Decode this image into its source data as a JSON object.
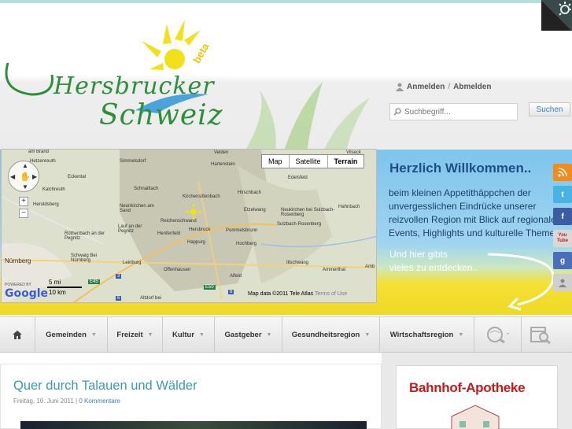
{
  "header": {
    "logo_line1": "Hersbrucker",
    "logo_line2": "Schweiz",
    "logo_badge": "beta",
    "login_label": "Anmelden",
    "logout_label": "Abmelden",
    "login_separator": "/",
    "search_placeholder": "Suchbegriff...",
    "search_button": "Suchen"
  },
  "map": {
    "type_buttons": [
      "Map",
      "Satellite",
      "Terrain"
    ],
    "selected_type": "Terrain",
    "places": [
      {
        "name": "am Brand"
      },
      {
        "name": "Hetzenreuth"
      },
      {
        "name": "Simmelsdorf"
      },
      {
        "name": "Hartenstein"
      },
      {
        "name": "Velden"
      },
      {
        "name": "Vilseck"
      },
      {
        "name": "Eckental"
      },
      {
        "name": "Kalchreuth"
      },
      {
        "name": "Schnaittach"
      },
      {
        "name": "Kirchensittenbach"
      },
      {
        "name": "Hirschbach"
      },
      {
        "name": "Edelsfeld"
      },
      {
        "name": "Heroldsberg"
      },
      {
        "name": "Neunkirchen am Sand"
      },
      {
        "name": "Etzelwang"
      },
      {
        "name": "Neukirchen bei Sulzbach-Rosenberg"
      },
      {
        "name": "Hahnbach"
      },
      {
        "name": "Lauf an der Pegnitz"
      },
      {
        "name": "Reichenschwand"
      },
      {
        "name": "Hersbruck"
      },
      {
        "name": "Pommelsbrunn"
      },
      {
        "name": "Sulzbach-Rosenberg"
      },
      {
        "name": "Röthenbach an der Pegnitz"
      },
      {
        "name": "Henfenfeld"
      },
      {
        "name": "Happurg"
      },
      {
        "name": "Hochberg"
      },
      {
        "name": "Nürnberg"
      },
      {
        "name": "Schwaig Bei Nürnberg"
      },
      {
        "name": "Leinburg"
      },
      {
        "name": "Offenhausen"
      },
      {
        "name": "Illschwang"
      },
      {
        "name": "Ammerthal"
      },
      {
        "name": "Alfeld"
      },
      {
        "name": "Altdorf bei"
      },
      {
        "name": "Amb"
      }
    ],
    "road_labels": [
      "E45",
      "E50",
      "3",
      "6",
      "6"
    ],
    "scale_miles": "5 mi",
    "scale_km": "10 km",
    "powered_by": "POWERED BY",
    "google_logo": "Google",
    "copyright": "Map data ©2011 Tele Atlas",
    "terms": "Terms of Use"
  },
  "welcome": {
    "title": "Herzlich Willkommen..",
    "text": "beim kleinen Appetithäppchen der unvergesslichen Eindrücke unserer reizvollen Region mit Blick auf regionale Events, Highlights und kulturelle Themen.",
    "more_line1": "Und hier gibts",
    "more_line2": "vieles zu entdecken.."
  },
  "social": [
    {
      "name": "rss",
      "label": "RSS",
      "color": "#f28b1e"
    },
    {
      "name": "twitter",
      "label": "t",
      "color": "#4ab3e3"
    },
    {
      "name": "facebook",
      "label": "f",
      "color": "#3b5c9e"
    },
    {
      "name": "youtube",
      "label": "You Tube",
      "color": "#d8d8d8"
    },
    {
      "name": "google",
      "label": "g",
      "color": "#4a6eb8"
    },
    {
      "name": "person",
      "label": "",
      "color": "#cfcfcf"
    }
  ],
  "nav": {
    "items": [
      {
        "label": "Gemeinden",
        "width": 0
      },
      {
        "label": "Freizeit"
      },
      {
        "label": "Kultur"
      },
      {
        "label": "Gastgeber"
      },
      {
        "label": "Gesundheitsregion"
      },
      {
        "label": "Wirtschaftsregion"
      }
    ]
  },
  "post": {
    "title": "Quer durch Talauen und Wälder",
    "date": "Freitag, 10. Juni 2011",
    "separator": "|",
    "comments": "0 Kommentare"
  },
  "sidebar": {
    "ad_title": "Bahnhof-Apotheke"
  },
  "colors": {
    "accent_blue": "#3b9ab5",
    "logo_green": "#2e8f3a",
    "sun_yellow": "#f2e11a",
    "ad_red": "#c41a1a"
  }
}
